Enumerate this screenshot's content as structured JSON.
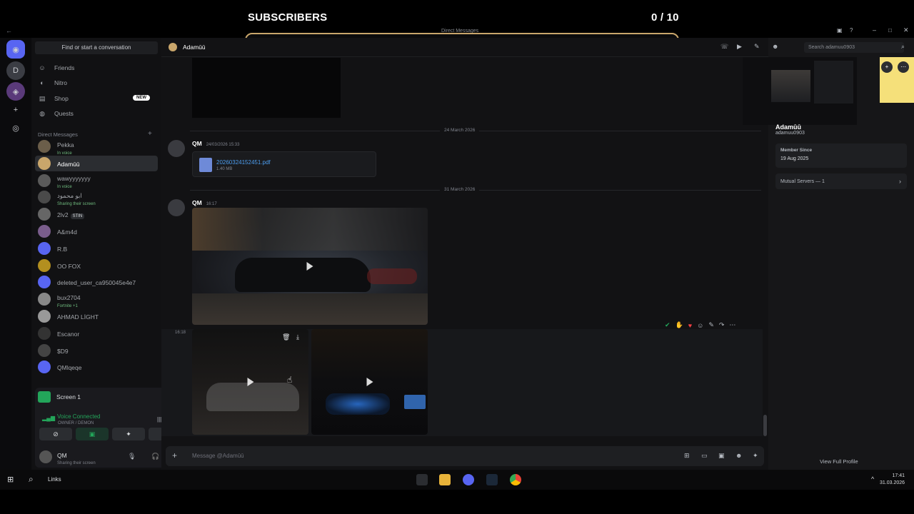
{
  "overlay": {
    "label": "SUBSCRIBERS",
    "count": "0 / 10"
  },
  "window": {
    "title": "Direct Messages"
  },
  "sidebar": {
    "find_placeholder": "Find or start a conversation",
    "nav": [
      {
        "label": "Friends",
        "icon": "friends-icon"
      },
      {
        "label": "Nitro",
        "icon": "nitro-icon"
      },
      {
        "label": "Shop",
        "icon": "shop-icon",
        "badge": "NEW"
      },
      {
        "label": "Quests",
        "icon": "quests-icon"
      }
    ],
    "dm_header": "Direct Messages",
    "dms": [
      {
        "name": "Pekka",
        "sub": "In voice",
        "color": "#6b5e4a"
      },
      {
        "name": "Adamūū",
        "sub": "",
        "color": "#c9a66b"
      },
      {
        "name": "wawyyyyyyy",
        "sub": "In voice",
        "color": "#5a5a5a"
      },
      {
        "name": "ابو محمود",
        "sub": "Sharing their screen",
        "color": "#4a4a4a"
      },
      {
        "name": "2lv2",
        "sub": "",
        "tag": "STIN",
        "color": "#666"
      },
      {
        "name": "A&m4d",
        "sub": "",
        "color": "#7a5d8c"
      },
      {
        "name": "R.B",
        "sub": "",
        "color": "#5865f2"
      },
      {
        "name": "OO FOX",
        "sub": "",
        "color": "#b38f1f"
      },
      {
        "name": "deleted_user_ca950045e4e7",
        "sub": "",
        "color": "#5865f2"
      },
      {
        "name": "bux2704",
        "sub": "Fortnite +1",
        "color": "#888"
      },
      {
        "name": "AHMAD LİGHT",
        "sub": "",
        "color": "#999"
      },
      {
        "name": "Escanor",
        "sub": "",
        "color": "#333"
      },
      {
        "name": "$D9",
        "sub": "",
        "color": "#444"
      },
      {
        "name": "QMlqeqe",
        "sub": "",
        "color": "#5865f2"
      }
    ],
    "screen_label": "Screen 1",
    "voice_status": "Voice Connected",
    "voice_channel": "OWNER / DEMON",
    "user": {
      "name": "QM",
      "status": "Sharing their screen"
    }
  },
  "chat": {
    "recipient": "Adamūū",
    "search_placeholder": "Search adamuu0903",
    "date1": "24 March 2026",
    "msg1": {
      "author": "QM",
      "time": "24/03/2026 15:33"
    },
    "file": {
      "name": "20260324152451.pdf",
      "size": "1.40 MB"
    },
    "date2": "31 March 2026",
    "msg2": {
      "author": "QM",
      "time": "16:17"
    },
    "msg3_time": "16:18",
    "composer_placeholder": "Message @Adamūū"
  },
  "profile": {
    "display_name": "Adamūū",
    "username": "adamuu0903",
    "member_since_label": "Member Since",
    "member_since": "19 Aug 2025",
    "mutual_servers": "Mutual Servers — 1",
    "view_full": "View Full Profile"
  },
  "taskbar": {
    "search_label": "Links",
    "time": "17:41",
    "date": "31.03.2026"
  }
}
